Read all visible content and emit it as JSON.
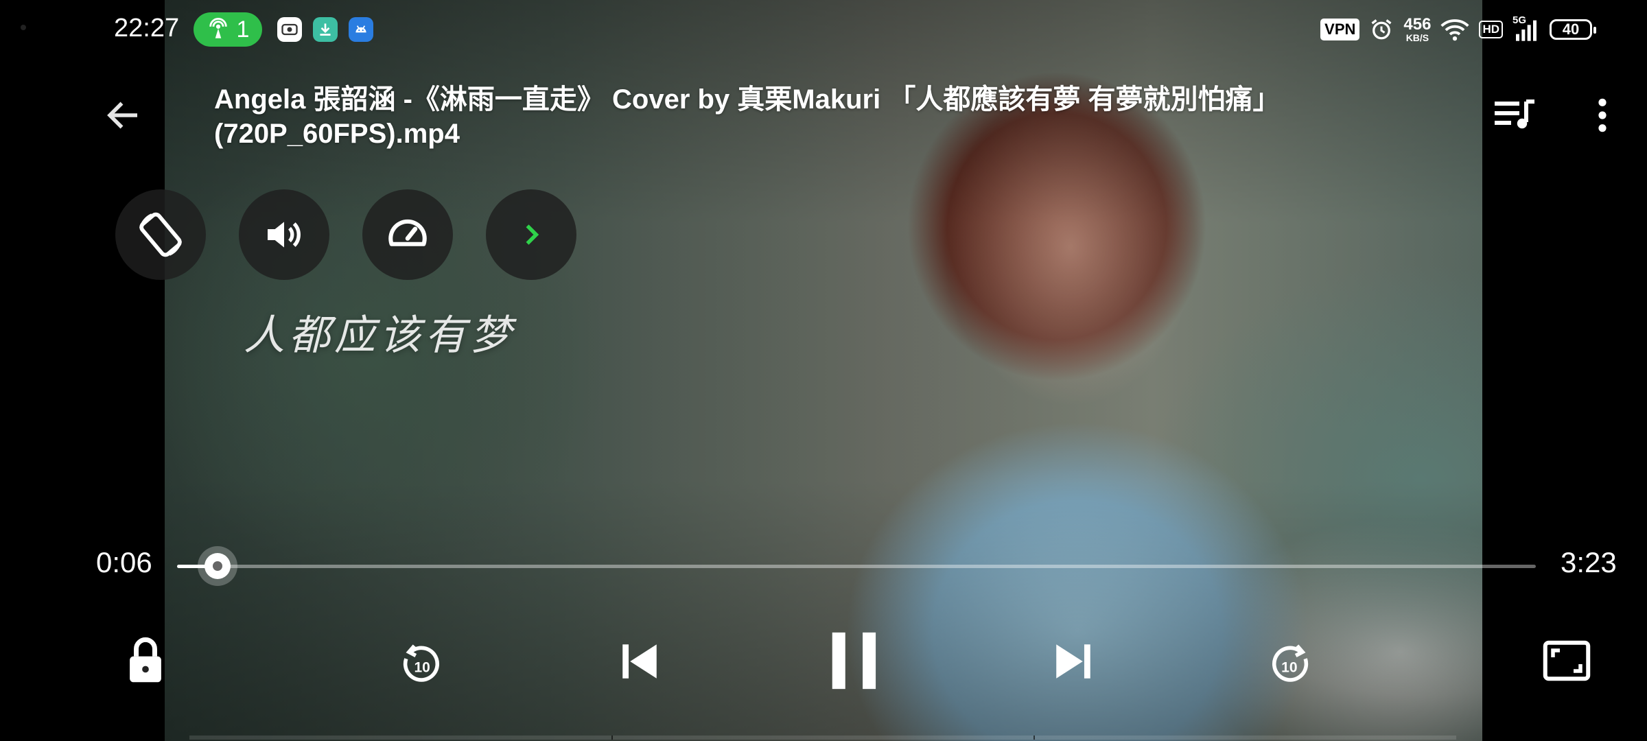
{
  "status_bar": {
    "time": "22:27",
    "hotspot_count": "1",
    "vpn": "VPN",
    "net_speed_value": "456",
    "net_speed_unit": "KB/S",
    "hd": "HD",
    "network_type": "5G",
    "battery": "40",
    "notification_icons": [
      "screen-record-icon",
      "download-icon",
      "android-icon"
    ]
  },
  "header": {
    "title": "Angela 張韶涵 -《淋雨一直走》 Cover by 真栗Makuri 「人都應該有夢 有夢就別怕痛」(720P_60FPS).mp4"
  },
  "quick_controls": [
    "rotate-screen-icon",
    "volume-icon",
    "speed-icon",
    "expand-more-icon"
  ],
  "video": {
    "burned_caption": "人都应该有梦"
  },
  "playback": {
    "current_time": "0:06",
    "total_time": "3:23",
    "progress": 0.03,
    "rewind_seconds": "10",
    "forward_seconds": "10",
    "state": "playing"
  },
  "colors": {
    "accent_green": "#2fbf4a",
    "control_bg": "#1e1e1e"
  }
}
